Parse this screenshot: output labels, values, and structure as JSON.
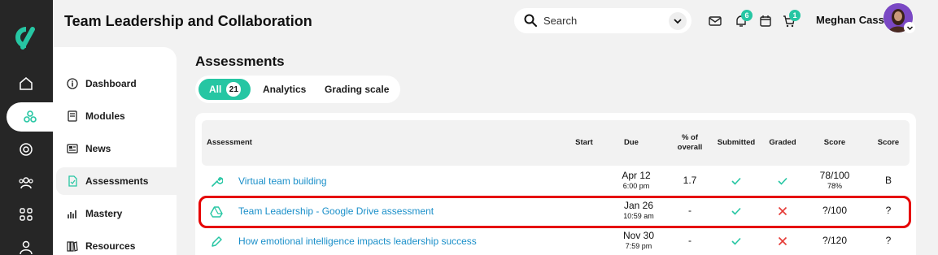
{
  "header": {
    "course_title": "Team Leadership and Collaboration",
    "search_placeholder": "Search",
    "notifications_count": "6",
    "cart_count": "1",
    "user_name": "Meghan Cass"
  },
  "rail": {
    "items": [
      "home-icon",
      "courses-icon",
      "target-icon",
      "people-icon",
      "apps-icon",
      "profile-icon"
    ]
  },
  "subnav": {
    "items": [
      {
        "label": "Dashboard",
        "icon": "info-icon"
      },
      {
        "label": "Modules",
        "icon": "book-icon"
      },
      {
        "label": "News",
        "icon": "newspaper-icon"
      },
      {
        "label": "Assessments",
        "icon": "document-icon",
        "active": true
      },
      {
        "label": "Mastery",
        "icon": "bar-chart-icon"
      },
      {
        "label": "Resources",
        "icon": "library-icon"
      }
    ]
  },
  "main": {
    "title": "Assessments",
    "tabs": {
      "all_label": "All",
      "all_count": "21",
      "analytics_label": "Analytics",
      "grading_label": "Grading scale"
    },
    "table": {
      "headers": {
        "assessment": "Assessment",
        "start": "Start",
        "due": "Due",
        "pct_line1": "% of",
        "pct_line2": "overall",
        "submitted": "Submitted",
        "graded": "Graded",
        "score": "Score",
        "score_letter": "Score"
      },
      "rows": [
        {
          "name": "Virtual team building",
          "icon": "wrench-icon",
          "start": "",
          "due_date": "Apr 12",
          "due_time": "6:00 pm",
          "pct": "1.7",
          "submitted": "check",
          "graded": "check",
          "score": "78/100",
          "score_pct": "78%",
          "letter": "B"
        },
        {
          "name": "Team Leadership - Google Drive assessment",
          "icon": "google-drive-icon",
          "start": "",
          "due_date": "Jan 26",
          "due_time": "10:59 am",
          "pct": "-",
          "submitted": "check",
          "graded": "cross",
          "score": "?/100",
          "score_pct": "",
          "letter": "?"
        },
        {
          "name": "How emotional intelligence impacts leadership success",
          "icon": "pencil-icon",
          "start": "",
          "due_date": "Nov 30",
          "due_time": "7:59 pm",
          "pct": "-",
          "submitted": "check",
          "graded": "cross",
          "score": "?/120",
          "score_pct": "",
          "letter": "?"
        }
      ]
    }
  },
  "colors": {
    "accent": "#26c6a3",
    "link": "#1a8fc9",
    "error": "#e53935",
    "highlight": "#e60000"
  }
}
